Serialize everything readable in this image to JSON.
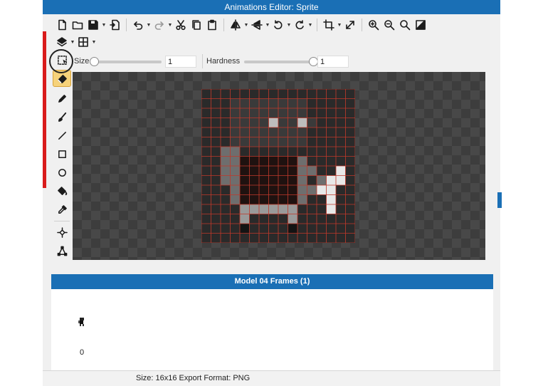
{
  "window": {
    "title": "Animations Editor: Sprite"
  },
  "toolbar": {
    "size_label": "Size",
    "size_value": 0.0,
    "size_input": "1",
    "hardness_label": "Hardness",
    "hardness_value": 1.0,
    "hardness_input": "1"
  },
  "tools": {
    "active": "eraser",
    "items": [
      "marquee-select",
      "eraser",
      "pencil",
      "brush",
      "line",
      "rectangle",
      "ellipse",
      "fill",
      "eyedropper",
      "move-point",
      "nodes"
    ]
  },
  "sprite": {
    "size": 16,
    "colors": {
      "K": "#141414",
      "D": "#1f1210",
      "H": "#3a3a3a",
      "M": "#6e6e6e",
      "L": "#9a9a9a",
      "W": "#e8e8e8",
      "S": "#bdbdbd"
    },
    "grid_color": "#c0392b",
    "rows": [
      "................",
      "...HHHHHHHH.....",
      "...HHHHHHHH.....",
      "...HHHHSHHSH....",
      "...HHHHHHHH.....",
      "...HHHHHHHH.....",
      "..MM.............",
      "..MMDDDDDDM......",
      "..MMDDDDDDMM..W..",
      "..MMDDDDDDM.MWW..",
      "...MDDDDDDMMWW...",
      "...MDDDDDDM..W...",
      "....LLLLLL...W...",
      "....L....L.......",
      "....K....K.......",
      "................"
    ]
  },
  "frames_panel": {
    "title": "Model 04 Frames (1)",
    "frames": [
      {
        "label": "0"
      }
    ]
  },
  "status": {
    "text": "Size: 16x16   Export Format: PNG"
  },
  "colors": {
    "accent": "#1a6fb5",
    "active_tool": "#f6d27a"
  }
}
